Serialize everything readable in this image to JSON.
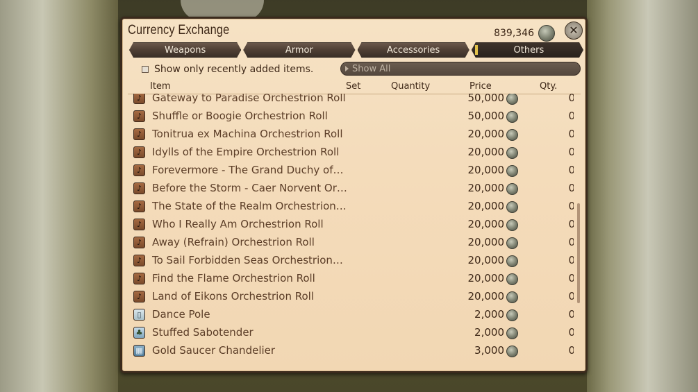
{
  "window": {
    "title": "Currency Exchange",
    "currency_amount": "839,346",
    "close_icon": "close-icon"
  },
  "tabs": [
    {
      "label": "Weapons",
      "active": false
    },
    {
      "label": "Armor",
      "active": false
    },
    {
      "label": "Accessories",
      "active": false
    },
    {
      "label": "Others",
      "active": true
    }
  ],
  "filter": {
    "checkbox_label": "Show only recently added items.",
    "checked": false,
    "dropdown_value": "Show All"
  },
  "columns": {
    "item": "Item",
    "set": "Set",
    "quantity": "Quantity",
    "price": "Price",
    "qty": "Qty."
  },
  "rows": [
    {
      "icon": "orchestrion-roll-icon",
      "name": "Gateway to Paradise Orchestrion Roll",
      "price": "50,000",
      "qty": "0"
    },
    {
      "icon": "orchestrion-roll-icon",
      "name": "Shuffle or Boogie Orchestrion Roll",
      "price": "50,000",
      "qty": "0"
    },
    {
      "icon": "orchestrion-roll-icon",
      "name": "Tonitrua ex Machina Orchestrion Roll",
      "price": "20,000",
      "qty": "0"
    },
    {
      "icon": "orchestrion-roll-icon",
      "name": "Idylls of the Empire Orchestrion Roll",
      "price": "20,000",
      "qty": "0"
    },
    {
      "icon": "orchestrion-roll-icon",
      "name": "Forevermore - The Grand Duchy of…",
      "price": "20,000",
      "qty": "0"
    },
    {
      "icon": "orchestrion-roll-icon",
      "name": "Before the Storm - Caer Norvent Or…",
      "price": "20,000",
      "qty": "0"
    },
    {
      "icon": "orchestrion-roll-icon",
      "name": "The State of the Realm Orchestrion…",
      "price": "20,000",
      "qty": "0"
    },
    {
      "icon": "orchestrion-roll-icon",
      "name": "Who I Really Am Orchestrion Roll",
      "price": "20,000",
      "qty": "0"
    },
    {
      "icon": "orchestrion-roll-icon",
      "name": "Away (Refrain) Orchestrion Roll",
      "price": "20,000",
      "qty": "0"
    },
    {
      "icon": "orchestrion-roll-icon",
      "name": "To Sail Forbidden Seas Orchestrion…",
      "price": "20,000",
      "qty": "0"
    },
    {
      "icon": "orchestrion-roll-icon",
      "name": "Find the Flame Orchestrion Roll",
      "price": "20,000",
      "qty": "0"
    },
    {
      "icon": "orchestrion-roll-icon",
      "name": "Land of Eikons Orchestrion Roll",
      "price": "20,000",
      "qty": "0"
    },
    {
      "icon": "dance-pole-icon",
      "name": "Dance Pole",
      "price": "2,000",
      "qty": "0"
    },
    {
      "icon": "sabotender-icon",
      "name": "Stuffed Sabotender",
      "price": "2,000",
      "qty": "0"
    },
    {
      "icon": "chandelier-icon",
      "name": "Gold Saucer Chandelier",
      "price": "3,000",
      "qty": "0"
    }
  ]
}
